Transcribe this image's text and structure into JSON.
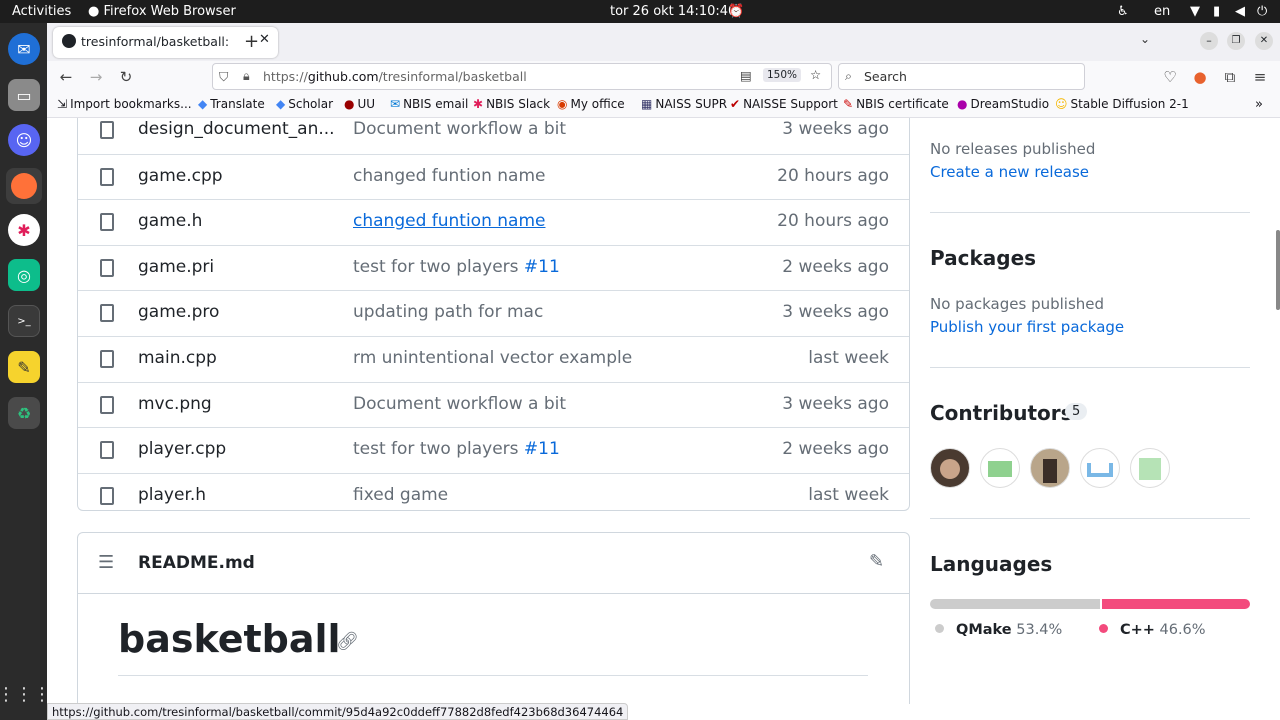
{
  "system": {
    "activities": "Activities",
    "app_name": "Firefox Web Browser",
    "datetime": "tor 26 okt  14:10:40",
    "language": "en"
  },
  "browser": {
    "tab_title": "tresinformal/basketball:",
    "url_prefix": "https://",
    "url_host": "github.com",
    "url_path": "/tresinformal/basketball",
    "zoom": "150%",
    "search_placeholder": "Search",
    "bookmarks": [
      {
        "label": "Import bookmarks...",
        "icon": "import-icon"
      },
      {
        "label": "Translate",
        "icon": "translate-icon"
      },
      {
        "label": "Scholar",
        "icon": "scholar-icon"
      },
      {
        "label": "UU",
        "icon": "uu-icon"
      },
      {
        "label": "NBIS email",
        "icon": "mail-icon"
      },
      {
        "label": "NBIS Slack",
        "icon": "slack-icon"
      },
      {
        "label": "My office",
        "icon": "office-icon"
      },
      {
        "label": "NAISS SUPR",
        "icon": "grid-icon"
      },
      {
        "label": "NAISSE Support",
        "icon": "support-icon"
      },
      {
        "label": "NBIS certificate",
        "icon": "certificate-icon"
      },
      {
        "label": "DreamStudio",
        "icon": "dream-icon"
      },
      {
        "label": "Stable Diffusion 2-1",
        "icon": "hug-icon"
      }
    ],
    "status_url": "https://github.com/tresinformal/basketball/commit/95d4a92c0ddeff77882d8fedf423b68d36474464"
  },
  "files": [
    {
      "name": "design_document_an...",
      "message": "Document workflow a bit",
      "message_link": "",
      "time": "3 weeks ago"
    },
    {
      "name": "game.cpp",
      "message": "changed funtion name",
      "message_link": "",
      "time": "20 hours ago"
    },
    {
      "name": "game.h",
      "message": "changed funtion name",
      "message_link": "",
      "time": "20 hours ago"
    },
    {
      "name": "game.pri",
      "message": "test for two players ",
      "message_link": "#11",
      "time": "2 weeks ago"
    },
    {
      "name": "game.pro",
      "message": "updating path for mac",
      "message_link": "",
      "time": "3 weeks ago"
    },
    {
      "name": "main.cpp",
      "message": "rm unintentional vector example",
      "message_link": "",
      "time": "last week"
    },
    {
      "name": "mvc.png",
      "message": "Document workflow a bit",
      "message_link": "",
      "time": "3 weeks ago"
    },
    {
      "name": "player.cpp",
      "message": "test for two players ",
      "message_link": "#11",
      "time": "2 weeks ago"
    },
    {
      "name": "player.h",
      "message": "fixed game",
      "message_link": "",
      "time": "last week"
    }
  ],
  "readme": {
    "filename": "README.md",
    "title": "basketball"
  },
  "sidebar": {
    "releases_text": "No releases published",
    "releases_link": "Create a new release",
    "packages_heading": "Packages",
    "packages_text": "No packages published",
    "packages_link": "Publish your first package",
    "contributors_heading": "Contributors",
    "contributors_count": "5",
    "languages_heading": "Languages",
    "languages": [
      {
        "name": "QMake",
        "percent": "53.4%",
        "fraction": 0.534,
        "color": "#cccccc"
      },
      {
        "name": "C++",
        "percent": "46.6%",
        "fraction": 0.466,
        "color": "#f34b7d"
      }
    ]
  }
}
